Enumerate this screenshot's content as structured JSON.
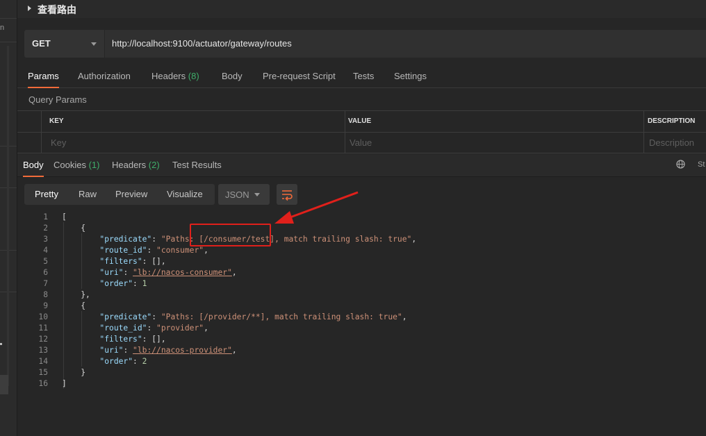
{
  "left_strip": {
    "partial_text": "n"
  },
  "header": {
    "title": "查看路由"
  },
  "request": {
    "method": "GET",
    "url": "http://localhost:9100/actuator/gateway/routes"
  },
  "request_tabs": [
    {
      "label": "Params",
      "count": ""
    },
    {
      "label": "Authorization",
      "count": ""
    },
    {
      "label": "Headers",
      "count": "(8)"
    },
    {
      "label": "Body",
      "count": ""
    },
    {
      "label": "Pre-request Script",
      "count": ""
    },
    {
      "label": "Tests",
      "count": ""
    },
    {
      "label": "Settings",
      "count": ""
    }
  ],
  "query_params": {
    "label": "Query Params",
    "headers": [
      "KEY",
      "VALUE",
      "DESCRIPTION"
    ],
    "placeholders": [
      "Key",
      "Value",
      "Description"
    ]
  },
  "response_tabs": [
    {
      "label": "Body",
      "count": ""
    },
    {
      "label": "Cookies",
      "count": "(1)"
    },
    {
      "label": "Headers",
      "count": "(2)"
    },
    {
      "label": "Test Results",
      "count": ""
    }
  ],
  "response_status_partial": "St",
  "view_modes": [
    "Pretty",
    "Raw",
    "Preview",
    "Visualize"
  ],
  "format": "JSON",
  "code_lines": [
    "1",
    "2",
    "3",
    "4",
    "5",
    "6",
    "7",
    "8",
    "9",
    "10",
    "11",
    "12",
    "13",
    "14",
    "15",
    "16"
  ],
  "code": {
    "l1": "[",
    "l2": "{",
    "l3_key": "\"predicate\"",
    "l3_val": "\"Paths: [/consumer/test], match trailing slash: true\"",
    "l4_key": "\"route_id\"",
    "l4_val": "\"consumer\"",
    "l5_key": "\"filters\"",
    "l5_val": "[]",
    "l6_key": "\"uri\"",
    "l6_val": "\"lb://nacos-consumer\"",
    "l7_key": "\"order\"",
    "l7_val": "1",
    "l8": "},",
    "l9": "{",
    "l10_key": "\"predicate\"",
    "l10_val": "\"Paths: [/provider/**], match trailing slash: true\"",
    "l11_key": "\"route_id\"",
    "l11_val": "\"provider\"",
    "l12_key": "\"filters\"",
    "l12_val": "[]",
    "l13_key": "\"uri\"",
    "l13_val": "\"lb://nacos-provider\"",
    "l14_key": "\"order\"",
    "l14_val": "2",
    "l15": "}",
    "l16": "]"
  },
  "colors": {
    "accent": "#f26b3a",
    "count_green": "#3fae6a",
    "annotation_red": "#e0201b",
    "json_key": "#9cdcfe",
    "json_string": "#ce9178",
    "json_number": "#b5cea8"
  }
}
